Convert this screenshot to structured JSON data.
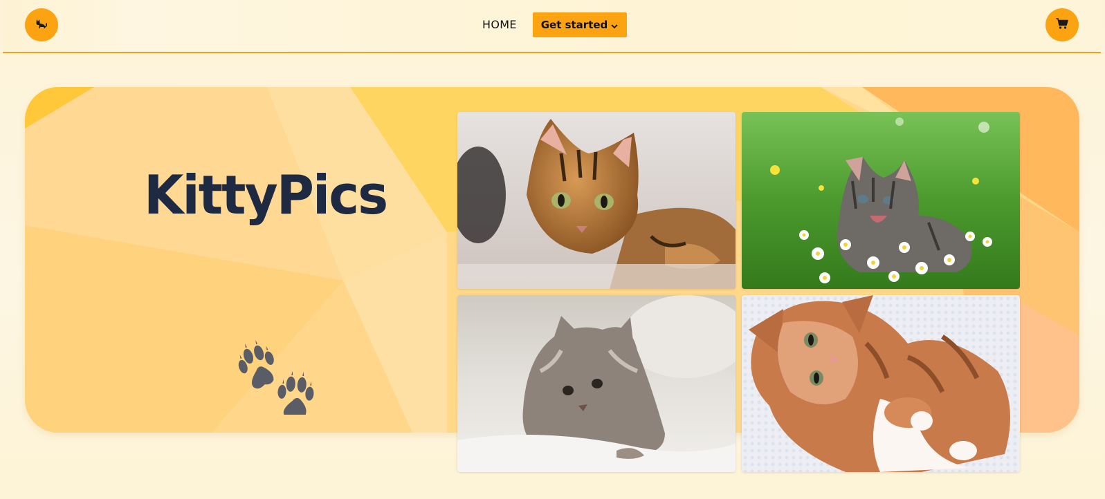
{
  "header": {
    "logo_icon": "cat-icon",
    "nav": {
      "home_label": "HOME",
      "get_started_label": "Get started"
    },
    "cart_icon": "cart-icon"
  },
  "hero": {
    "title": "KittyPics",
    "paw_icon": "paw-prints-icon",
    "photos": [
      {
        "subject": "tabby-cat-on-bed"
      },
      {
        "subject": "kitten-in-daisies"
      },
      {
        "subject": "fluffy-kitten-on-blanket"
      },
      {
        "subject": "ginger-kitten-lying-on-back"
      }
    ]
  },
  "colors": {
    "accent": "#fca311",
    "title": "#1e2a42",
    "hero_bg": "#ffd98a",
    "paws": "#5a5c66"
  }
}
